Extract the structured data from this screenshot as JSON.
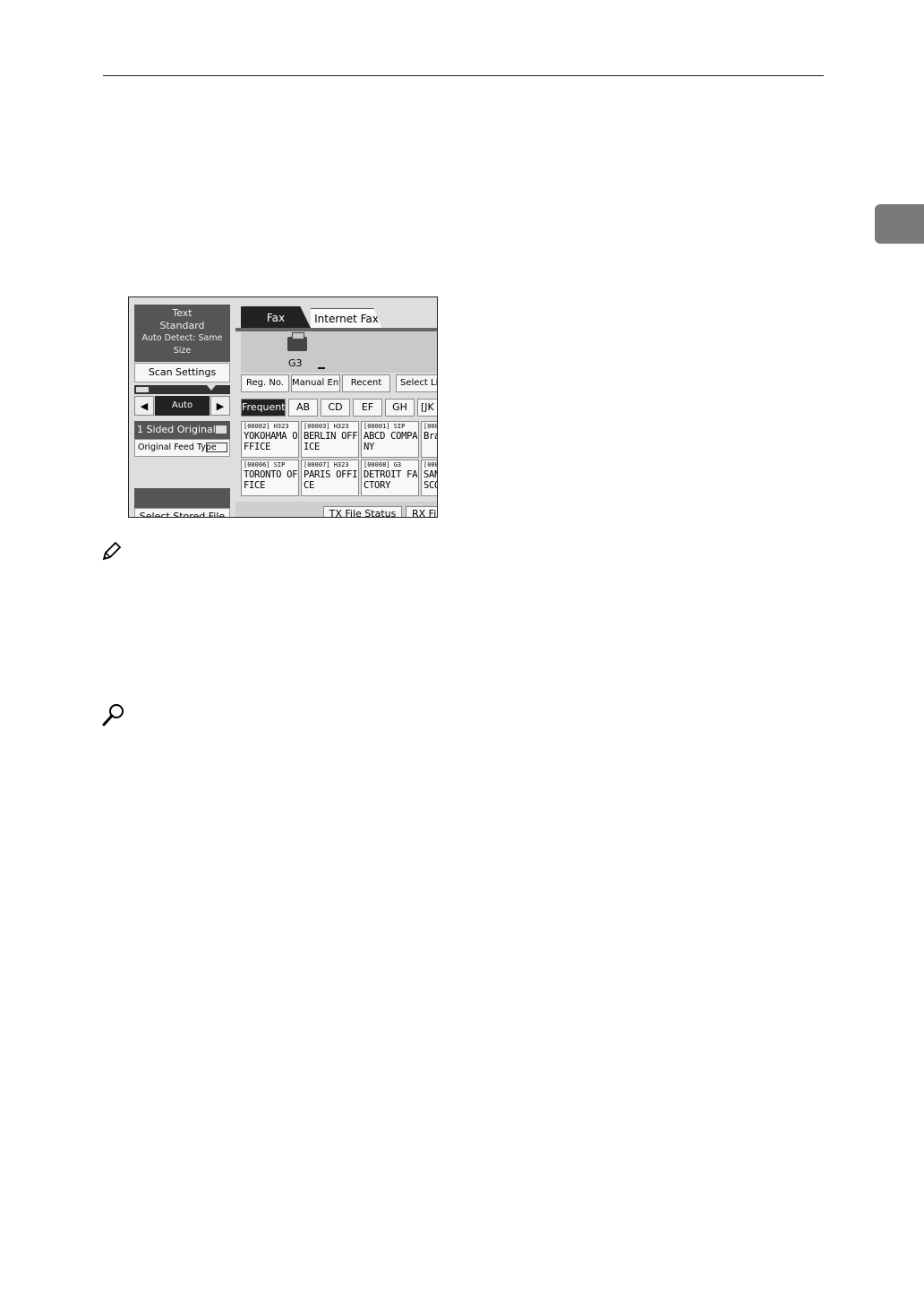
{
  "screen": {
    "mode": {
      "line1": "Text",
      "line2": "Standard",
      "line3": "Auto Detect: Same Size"
    },
    "scan_settings_label": "Scan Settings",
    "density_label": "Auto Density",
    "sided_label": "1 Sided Original",
    "feed_type_label": "Original Feed Type",
    "select_stored_label": "Select Stored File",
    "tabs": {
      "fax": "Fax",
      "internet_fax": "Internet Fax"
    },
    "line_label": "G3",
    "buttons": {
      "reg_no": "Reg. No.",
      "manual_entry": "Manual Entry",
      "recent": "Recent",
      "select_line": "Select Lin"
    },
    "index_tabs": [
      "Frequent",
      "AB",
      "CD",
      "EF",
      "GH",
      "[JK"
    ],
    "destinations": [
      {
        "code": "[00002] H323",
        "name": "YOKOHAMA O\nFFICE"
      },
      {
        "code": "[00003] H323",
        "name": "BERLIN OFF\nICE"
      },
      {
        "code": "[00001] SIP",
        "name": "ABCD COMPA\nNY"
      },
      {
        "code": "[000",
        "name": "Bra"
      },
      {
        "code": "[00006] SIP",
        "name": "TORONTO OF\nFICE"
      },
      {
        "code": "[00007] H323",
        "name": "PARIS OFFI\nCE"
      },
      {
        "code": "[00008] G3",
        "name": "DETROIT FA\nCTORY"
      },
      {
        "code": "[000",
        "name": "SAN\nSCO"
      }
    ],
    "bottom_buttons": {
      "tx_file_status": "TX File Status",
      "rx_file": "RX Fi"
    }
  }
}
